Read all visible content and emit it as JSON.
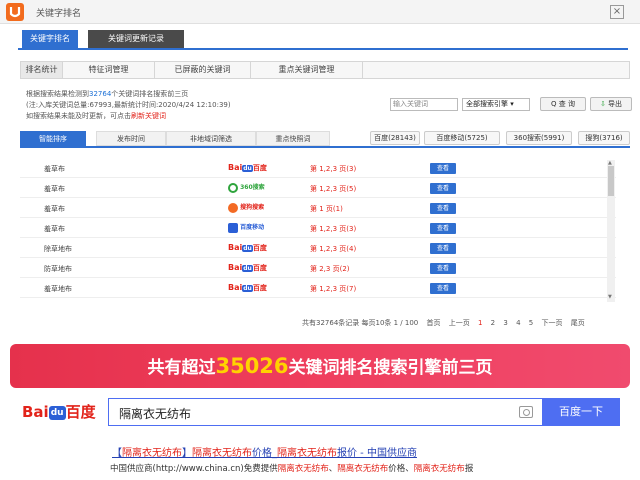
{
  "window": {
    "title": "关键字排名",
    "close_glyph": "×"
  },
  "main_tabs": [
    {
      "label": "关键字排名",
      "active": true
    },
    {
      "label": "关键词更新记录",
      "active": false
    }
  ],
  "sub_tabs": [
    "排名统计",
    "特征词管理",
    "已屏蔽的关键词",
    "重点关键词管理"
  ],
  "info": {
    "line1_prefix": "根据搜索结果检测到",
    "line1_count": "32764",
    "line1_suffix": "个关键词排名搜索前三页",
    "line2": "(注:入库关键词总量:67993,最新统计时间:2020/4/24 12:10:39)",
    "line3_prefix": "如搜索结果未能及时更新，可点击",
    "line3_link": "刷新关键词"
  },
  "search": {
    "keyword_placeholder": "输入关键词",
    "engine_selected": "全部搜索引擎",
    "search_label": "Q 查 询",
    "export_label": "导出"
  },
  "list_tabs": [
    "智能排序",
    "发布时间",
    "非地域词筛选",
    "重点快照词"
  ],
  "engine_tabs": [
    "百度(28143)",
    "百度移动(5725)",
    "360搜索(5991)",
    "搜狗(3716)"
  ],
  "rows": [
    {
      "keyword": "羞草布",
      "engine": "baidu",
      "rank": "第 1,2,3 页(3)",
      "action": "查看"
    },
    {
      "keyword": "羞草布",
      "engine": "360",
      "rank": "第 1,2,3 页(5)",
      "action": "查看"
    },
    {
      "keyword": "羞草布",
      "engine": "sogou",
      "rank": "第 1 页(1)",
      "action": "查看"
    },
    {
      "keyword": "羞草布",
      "engine": "baidu_mobile",
      "rank": "第 1,2,3 页(3)",
      "action": "查看"
    },
    {
      "keyword": "除草地布",
      "engine": "baidu",
      "rank": "第 1,2,3 页(4)",
      "action": "查看"
    },
    {
      "keyword": "防草地布",
      "engine": "baidu",
      "rank": "第 2,3 页(2)",
      "action": "查看"
    },
    {
      "keyword": "羞草地布",
      "engine": "baidu",
      "rank": "第 1,2,3 页(7)",
      "action": "查看"
    }
  ],
  "engine_labels": {
    "baidu_bai": "Bai",
    "baidu_paw": "du",
    "baidu_du": "百度",
    "e360": "360搜索",
    "sogou": "搜狗搜索",
    "baidu_mobile": "百度移动"
  },
  "pager": {
    "summary": "共有32764条记录 每页10条 1 / 100",
    "first": "首页",
    "prev": "上一页",
    "pages": [
      "1",
      "2",
      "3",
      "4",
      "5"
    ],
    "current_page": "1",
    "next": "下一页",
    "last": "尾页"
  },
  "banner": {
    "prefix": "共有超过",
    "number": "35026",
    "suffix": "关键词排名搜索引擎前三页"
  },
  "baidu": {
    "logo_bai": "Bai",
    "logo_paw": "du",
    "logo_du": "百度",
    "query": "隔离衣无纺布",
    "button": "百度一下"
  },
  "result": {
    "title_p1": "【",
    "title_e1": "隔离衣无纺布",
    "title_p2": "】",
    "title_e2": "隔离衣无纺布",
    "title_p3": "价格_",
    "title_e3": "隔离衣无纺布",
    "title_p4": "报价 - 中国供应商",
    "desc_p1": "中国供应商(http://www.china.cn)免费提供",
    "desc_e1": "隔离衣无纺布",
    "desc_p2": "、",
    "desc_e2": "隔离衣无纺布",
    "desc_p3": "价格、",
    "desc_e3": "隔离衣无纺布",
    "desc_p4": "报"
  },
  "colors": {
    "accent": "#2f6fd0",
    "rank_red": "#e2231a",
    "banner": "#ef3e5d",
    "banner_number": "#ffd200",
    "baidu_blue": "#4e6ef2"
  }
}
